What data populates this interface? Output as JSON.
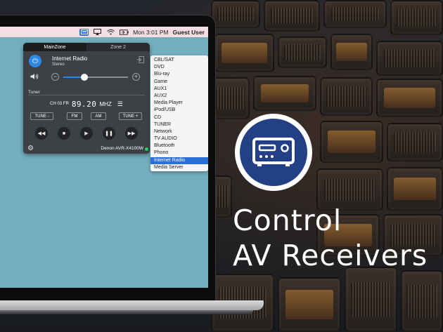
{
  "menubar": {
    "clock": "Mon 3:01 PM",
    "user": "Guest User",
    "icons": [
      "receiver-menu-icon",
      "airplay-icon",
      "wifi-icon",
      "battery-icon"
    ]
  },
  "app": {
    "zones": [
      "MainZone",
      "Zone 2"
    ],
    "source_name": "Internet Radio",
    "source_mode": "Stereo",
    "volume_fraction": 0.33,
    "tuner": {
      "section_title": "Tuner",
      "preset": "CH 03 FR",
      "frequency": "89.20",
      "unit": "MHZ",
      "buttons": {
        "tune_down": "TUNE -",
        "fm": "FM",
        "am": "AM",
        "tune_up": "TUNE +"
      }
    },
    "transport": {
      "rewind": "◀◀",
      "stop": "■",
      "play": "▶",
      "pause": "❚❚",
      "forward": "▶▶"
    },
    "device_name": "Denon AVR-X4100W",
    "status_color": "#1fd25b"
  },
  "sources": {
    "items": [
      "CBL/SAT",
      "DVD",
      "Blu-ray",
      "Game",
      "AUX1",
      "AUX2",
      "Media Player",
      "iPod/USB",
      "CD",
      "TUNER",
      "Network",
      "TV AUDIO",
      "Bluetooth",
      "Phono",
      "Internet Radio",
      "Media Server"
    ],
    "selected_index": 14
  },
  "promo": {
    "line1": "Control",
    "line2": "AV Receivers",
    "logo_icon": "av-receiver-icon",
    "logo_color": "#233f86"
  }
}
